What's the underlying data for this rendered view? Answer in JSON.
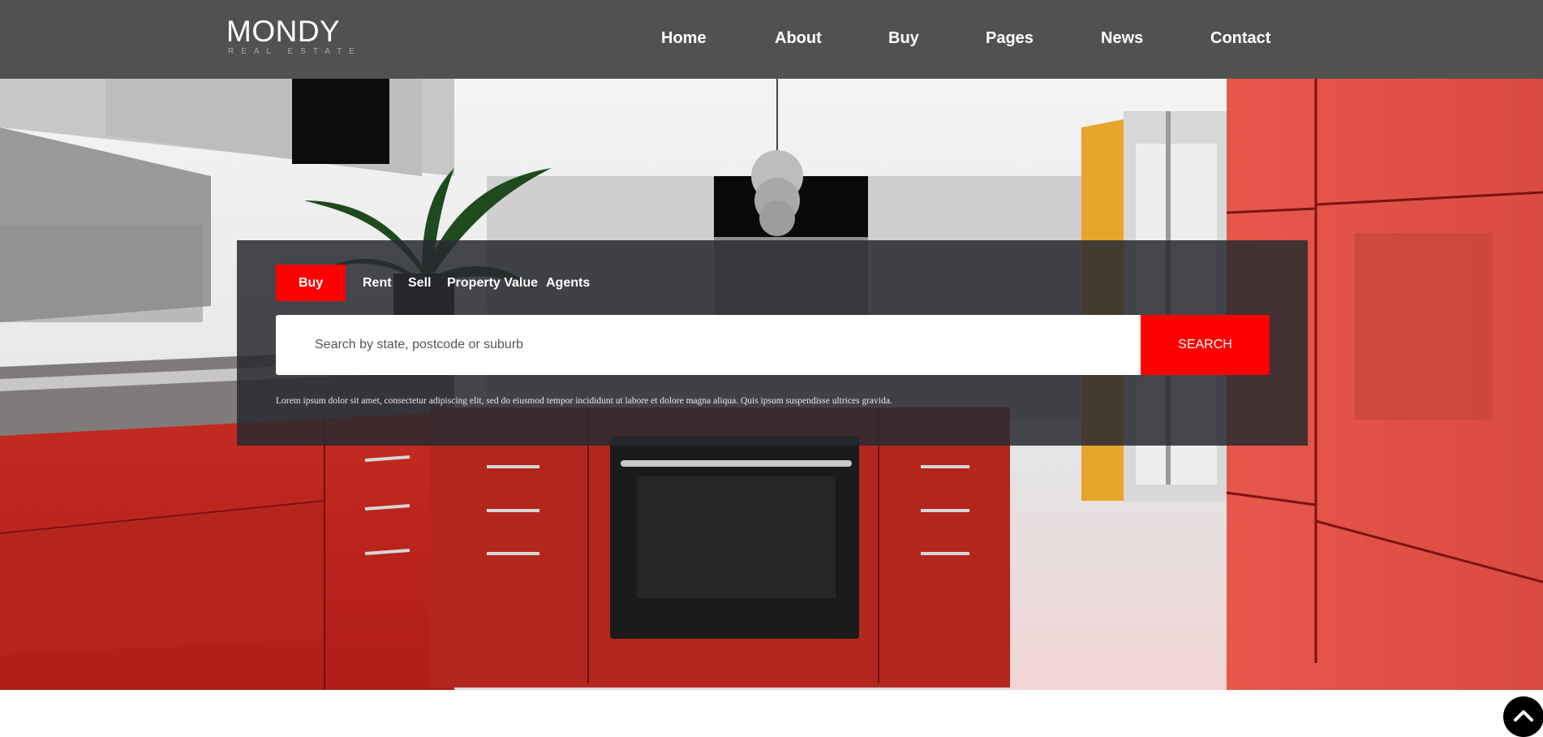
{
  "brand": {
    "name": "MONDY",
    "tagline": "REAL ESTATE"
  },
  "nav": {
    "items": [
      {
        "label": "Home"
      },
      {
        "label": "About"
      },
      {
        "label": "Buy"
      },
      {
        "label": "Pages"
      },
      {
        "label": "News"
      },
      {
        "label": "Contact"
      }
    ]
  },
  "search": {
    "tabs": [
      {
        "label": "Buy",
        "active": true
      },
      {
        "label": "Rent"
      },
      {
        "label": "Sell"
      },
      {
        "label": "Property Value"
      },
      {
        "label": "Agents"
      }
    ],
    "placeholder": "Search by state, postcode or suburb",
    "button_label": "SEARCH",
    "note": "Lorem ipsum dolor sit amet, consectetur adipiscing elit, sed do eiusmod tempor incididunt ut labore et dolore magna aliqua. Quis ipsum suspendisse ultrices gravida."
  },
  "icons": {
    "scroll_top": "chevron-up-icon"
  },
  "colors": {
    "header": "#515151",
    "accent": "#ff0000",
    "panel": "#282a30"
  }
}
